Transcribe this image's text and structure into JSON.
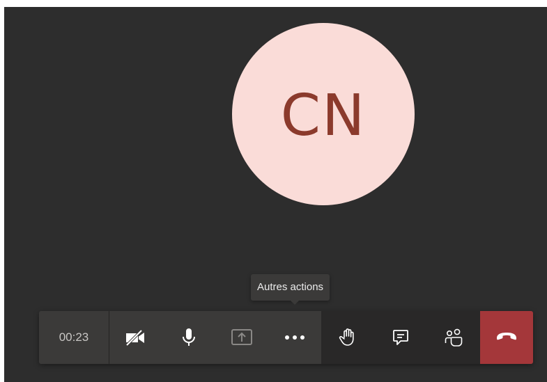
{
  "call": {
    "avatar_initials": "CN",
    "avatar_bg": "#fadcd8",
    "avatar_fg": "#8b3a2c",
    "timer": "00:23",
    "tooltip": "Autres actions"
  },
  "controls": [
    {
      "icon": "camera-off-icon",
      "state": "off"
    },
    {
      "icon": "microphone-icon",
      "state": "on"
    },
    {
      "icon": "share-screen-icon",
      "state": "disabled"
    },
    {
      "icon": "more-actions-icon"
    },
    {
      "icon": "raise-hand-icon"
    },
    {
      "icon": "chat-icon"
    },
    {
      "icon": "participants-icon"
    },
    {
      "icon": "hang-up-icon"
    }
  ],
  "colors": {
    "background": "#2d2d2d",
    "bar_primary": "#3b3a39",
    "bar_secondary": "#292828",
    "hangup": "#a4373a",
    "icon": "#ffffff",
    "icon_disabled": "#8a8886"
  }
}
